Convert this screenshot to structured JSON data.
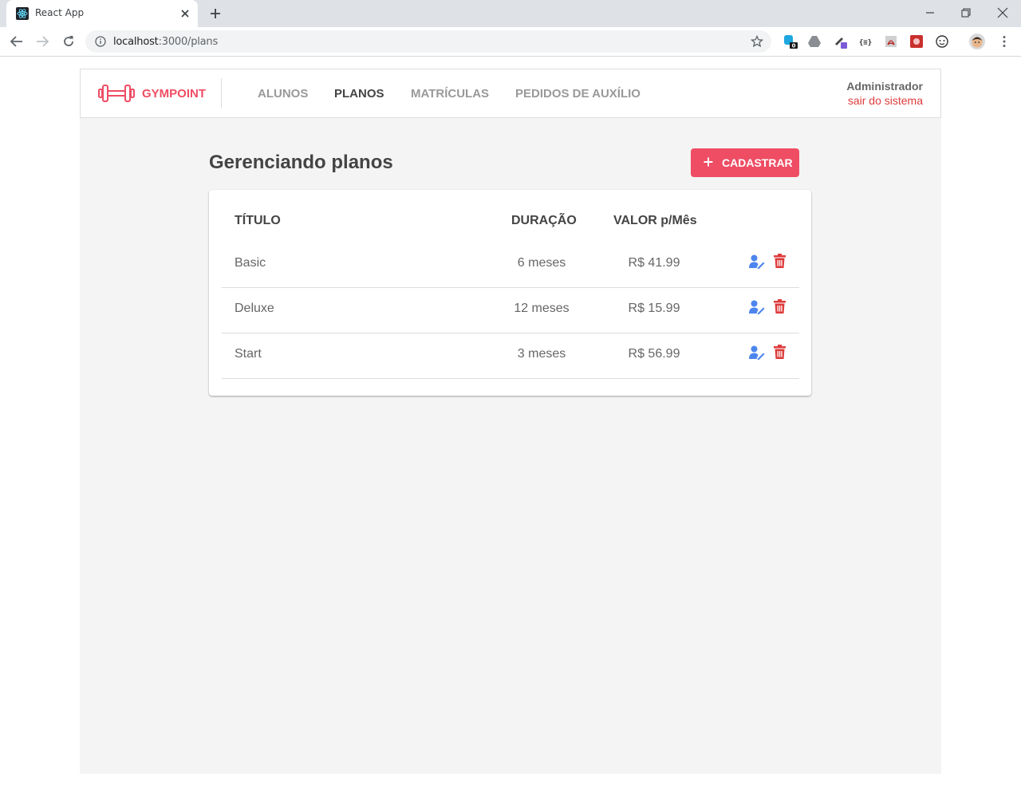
{
  "browser": {
    "tab_title": "React App",
    "url_host": "localhost",
    "url_path": ":3000/plans",
    "extension_badge": "0"
  },
  "header": {
    "brand": "GYMPOINT",
    "nav": [
      {
        "label": "ALUNOS",
        "active": false
      },
      {
        "label": "PLANOS",
        "active": true
      },
      {
        "label": "MATRÍCULAS",
        "active": false
      },
      {
        "label": "PEDIDOS DE AUXÍLIO",
        "active": false
      }
    ],
    "user_name": "Administrador",
    "logout_label": "sair do sistema"
  },
  "main": {
    "title": "Gerenciando planos",
    "add_button_label": "CADASTRAR",
    "table": {
      "headers": [
        "TÍTULO",
        "DURAÇÃO",
        "VALOR p/Mês"
      ],
      "rows": [
        {
          "title": "Basic",
          "duration": "6 meses",
          "price": "R$ 41.99"
        },
        {
          "title": "Deluxe",
          "duration": "12 meses",
          "price": "R$ 15.99"
        },
        {
          "title": "Start",
          "duration": "3 meses",
          "price": "R$ 56.99"
        }
      ]
    }
  },
  "colors": {
    "brand": "#ee4d64",
    "edit_icon": "#4d85ee",
    "delete_icon": "#de3b3b",
    "background": "#f4f4f4"
  }
}
